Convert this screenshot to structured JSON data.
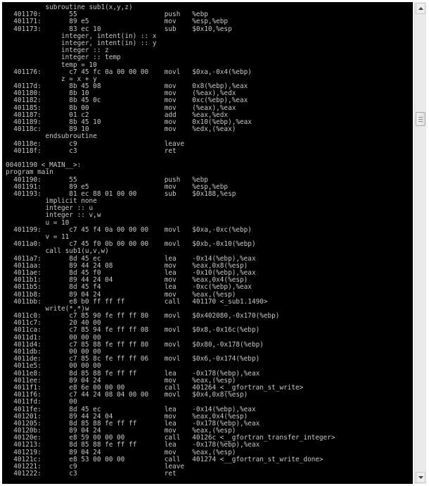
{
  "disassembly": {
    "lines": [
      "          subroutine sub1(x,y,z)",
      "  401170:       55                      push   %ebp",
      "  401171:       89 e5                   mov    %esp,%ebp",
      "  401173:       83 ec 10                sub    $0x10,%esp",
      "              integer, intent(in) :: x",
      "              integer, intent(in) :: y",
      "              integer :: z",
      "              integer :: temp",
      "              temp = 10",
      "  401176:       c7 45 fc 0a 00 00 00    movl   $0xa,-0x4(%ebp)",
      "              z = x + y",
      "  40117d:       8b 45 08                mov    0x8(%ebp),%eax",
      "  401180:       8b 10                   mov    (%eax),%edx",
      "  401182:       8b 45 0c                mov    0xc(%ebp),%eax",
      "  401185:       8b 00                   mov    (%eax),%eax",
      "  401187:       01 c2                   add    %eax,%edx",
      "  401189:       8b 45 10                mov    0x10(%ebp),%eax",
      "  40118c:       89 10                   mov    %edx,(%eax)",
      "          endsubroutine",
      "  40118e:       c9                      leave",
      "  40118f:       c3                      ret",
      "",
      "00401190 <_MAIN__>:",
      "program main",
      "  401190:       55                      push   %ebp",
      "  401191:       89 e5                   mov    %esp,%ebp",
      "  401193:       81 ec 88 01 00 00       sub    $0x188,%esp",
      "          implicit none",
      "          integer :: u",
      "          integer :: v,w",
      "          u = 10",
      "  401199:       c7 45 f4 0a 00 00 00    movl   $0xa,-0xc(%ebp)",
      "          v = 11",
      "  4011a0:       c7 45 f0 0b 00 00 00    movl   $0xb,-0x10(%ebp)",
      "          call sub1(u,v,w)",
      "  4011a7:       8d 45 ec                lea    -0x14(%ebp),%eax",
      "  4011aa:       89 44 24 08             mov    %eax,0x8(%esp)",
      "  4011ae:       8d 45 f0                lea    -0x10(%ebp),%eax",
      "  4011b1:       89 44 24 04             mov    %eax,0x4(%esp)",
      "  4011b5:       8d 45 f4                lea    -0xc(%ebp),%eax",
      "  4011b8:       89 04 24                mov    %eax,(%esp)",
      "  4011bb:       e8 b0 ff ff ff          call   401170 <_sub1.1490>",
      "          write(*,*)w",
      "  4011c0:       c7 85 90 fe ff ff 80    movl   $0x402080,-0x170(%ebp)",
      "  4011c7:       20 40 00",
      "  4011ca:       c7 85 94 fe ff ff 08    movl   $0x8,-0x16c(%ebp)",
      "  4011d1:       00 00 00",
      "  4011d4:       c7 85 88 fe ff ff 80    movl   $0x80,-0x178(%ebp)",
      "  4011db:       00 00 00",
      "  4011de:       c7 85 8c fe ff ff 06    movl   $0x6,-0x174(%ebp)",
      "  4011e5:       00 00 00",
      "  4011e8:       8d 85 88 fe ff ff       lea    -0x178(%ebp),%eax",
      "  4011ee:       89 04 24                mov    %eax,(%esp)",
      "  4011f1:       e8 6e 00 00 00          call   401264 <__gfortran_st_write>",
      "  4011f6:       c7 44 24 08 04 00 00    movl   $0x4,0x8(%esp)",
      "  4011fd:       00",
      "  4011fe:       8d 45 ec                lea    -0x14(%ebp),%eax",
      "  401201:       89 44 24 04             mov    %eax,0x4(%esp)",
      "  401205:       8d 85 88 fe ff ff       lea    -0x178(%ebp),%eax",
      "  40120b:       89 04 24                mov    %eax,(%esp)",
      "  40120e:       e8 59 00 00 00          call   40126c <__gfortran_transfer_integer>",
      "  401213:       8d 85 88 fe ff ff       lea    -0x178(%ebp),%eax",
      "  401219:       89 04 24                mov    %eax,(%esp)",
      "  40121c:       e8 53 00 00 00          call   401274 <__gfortran_st_write_done>",
      "  401221:       c9                      leave",
      "  401222:       c3                      ret"
    ]
  },
  "scrollbar": {
    "position_fraction": 0.22,
    "up_icon": "arrow-up-icon",
    "down_icon": "arrow-down-icon"
  },
  "colors": {
    "console_background": "#000000",
    "console_text": "#c8c8c8",
    "window_background": "#ffffff"
  }
}
